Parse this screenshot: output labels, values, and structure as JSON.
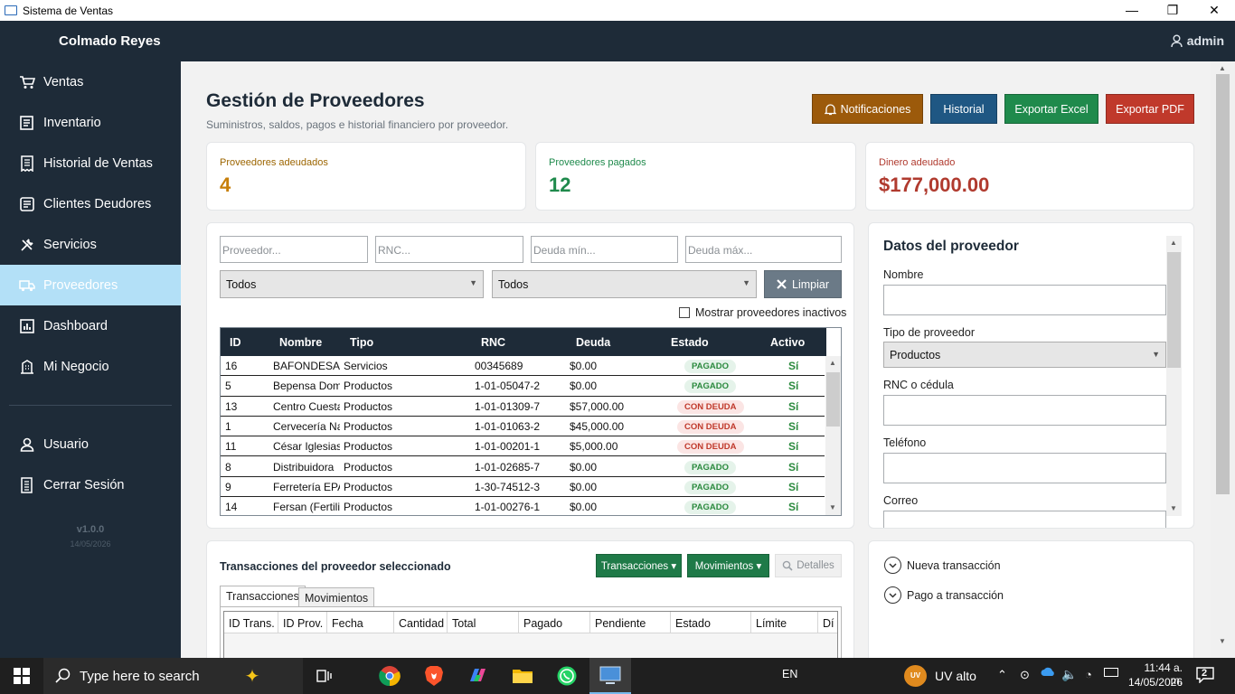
{
  "window": {
    "title": "Sistema de Ventas",
    "min": "—",
    "max": "❐",
    "close": "✕"
  },
  "topbar": {
    "brand": "Colmado Reyes",
    "user": "admin"
  },
  "sidebar": {
    "items": [
      {
        "label": "Ventas",
        "icon": "cart-icon"
      },
      {
        "label": "Inventario",
        "icon": "inventory-icon"
      },
      {
        "label": "Historial de Ventas",
        "icon": "receipt-icon"
      },
      {
        "label": "Clientes Deudores",
        "icon": "clients-icon"
      },
      {
        "label": "Servicios",
        "icon": "tools-icon"
      },
      {
        "label": "Proveedores",
        "icon": "truck-icon"
      },
      {
        "label": "Dashboard",
        "icon": "chart-icon"
      },
      {
        "label": "Mi Negocio",
        "icon": "building-icon"
      }
    ],
    "bottom": [
      {
        "label": "Usuario",
        "icon": "user-icon"
      },
      {
        "label": "Cerrar Sesión",
        "icon": "logout-icon"
      }
    ],
    "version": "v1.0.0",
    "date": "14/05/2026"
  },
  "header": {
    "title": "Gestión de Proveedores",
    "subtitle": "Suministros, saldos, pagos e historial financiero por proveedor.",
    "buttons": {
      "notif": "Notificaciones",
      "hist": "Historial",
      "excel": "Exportar Excel",
      "pdf": "Exportar PDF"
    }
  },
  "stats": {
    "owed_label": "Proveedores adeudados",
    "owed_value": "4",
    "paid_label": "Proveedores pagados",
    "paid_value": "12",
    "money_label": "Dinero adeudado",
    "money_value": "$177,000.00"
  },
  "filters": {
    "proveedor_ph": "Proveedor...",
    "rnc_ph": "RNC...",
    "min_ph": "Deuda mín...",
    "max_ph": "Deuda máx...",
    "tipo": "Todos",
    "estado": "Todos",
    "clear": "Limpiar",
    "inactive": "Mostrar proveedores inactivos"
  },
  "grid": {
    "headers": {
      "id": "ID",
      "nombre": "Nombre",
      "tipo": "Tipo",
      "rnc": "RNC",
      "deuda": "Deuda",
      "estado": "Estado",
      "activo": "Activo"
    },
    "rows": [
      {
        "id": "16",
        "nombre": "BAFONDESA",
        "tipo": "Servicios",
        "rnc": "00345689",
        "deuda": "$0.00",
        "estado": "PAGADO",
        "activo": "Sí"
      },
      {
        "id": "5",
        "nombre": "Bepensa Dom",
        "tipo": "Productos",
        "rnc": "1-01-05047-2",
        "deuda": "$0.00",
        "estado": "PAGADO",
        "activo": "Sí"
      },
      {
        "id": "13",
        "nombre": "Centro Cuesta",
        "tipo": "Productos",
        "rnc": "1-01-01309-7",
        "deuda": "$57,000.00",
        "estado": "CON DEUDA",
        "activo": "Sí"
      },
      {
        "id": "1",
        "nombre": "Cervecería Na",
        "tipo": "Productos",
        "rnc": "1-01-01063-2",
        "deuda": "$45,000.00",
        "estado": "CON DEUDA",
        "activo": "Sí"
      },
      {
        "id": "11",
        "nombre": "César Iglesias",
        "tipo": "Productos",
        "rnc": "1-01-00201-1",
        "deuda": "$5,000.00",
        "estado": "CON DEUDA",
        "activo": "Sí"
      },
      {
        "id": "8",
        "nombre": "Distribuidora",
        "tipo": "Productos",
        "rnc": "1-01-02685-7",
        "deuda": "$0.00",
        "estado": "PAGADO",
        "activo": "Sí"
      },
      {
        "id": "9",
        "nombre": "Ferretería EPA",
        "tipo": "Productos",
        "rnc": "1-30-74512-3",
        "deuda": "$0.00",
        "estado": "PAGADO",
        "activo": "Sí"
      },
      {
        "id": "14",
        "nombre": "Fersan (Fertiliz",
        "tipo": "Productos",
        "rnc": "1-01-00276-1",
        "deuda": "$0.00",
        "estado": "PAGADO",
        "activo": "Sí"
      }
    ]
  },
  "form": {
    "title": "Datos del proveedor",
    "nombre": "Nombre",
    "tipo": "Tipo de proveedor",
    "tipo_value": "Productos",
    "rnc": "RNC o cédula",
    "telefono": "Teléfono",
    "correo": "Correo"
  },
  "trans": {
    "title": "Transacciones del proveedor seleccionado",
    "btn_trans": "Transacciones ▾",
    "btn_mov": "Movimientos ▾",
    "btn_det": "Detalles",
    "tab1": "Transacciones",
    "tab2": "Movimientos",
    "cols": [
      "ID Trans.",
      "ID Prov.",
      "Fecha",
      "Cantidad",
      "Total",
      "Pagado",
      "Pendiente",
      "Estado",
      "Límite",
      "Dí"
    ]
  },
  "actions": {
    "nueva": "Nueva transacción",
    "pago": "Pago a transacción"
  },
  "taskbar": {
    "search": "Type here to search",
    "lang": "EN",
    "uv_badge": "UV",
    "uv": "UV alto",
    "time": "11:44 a. m.",
    "date": "14/05/2026",
    "notif": "2"
  },
  "colors": {
    "dark": "#1e2b38",
    "notif": "#9c5a0b",
    "hist": "#1f5783",
    "excel": "#1f8a4c",
    "pdf": "#c0392b",
    "active_nav": "#b3e0f7"
  }
}
